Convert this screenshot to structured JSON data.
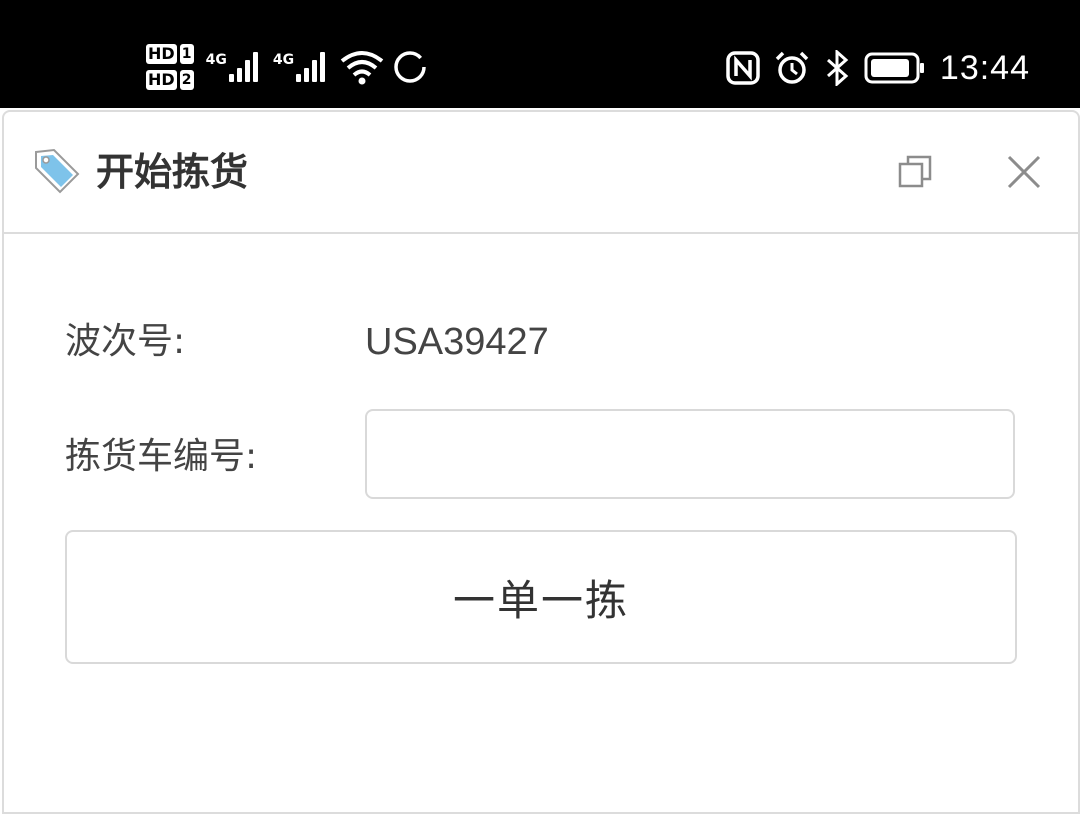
{
  "status_bar": {
    "hd1": "HD",
    "hd1_num": "1",
    "hd2": "HD",
    "hd2_num": "2",
    "network1": "4G",
    "network2": "4G",
    "time": "13:44",
    "icons": [
      "nfc-icon",
      "alarm-icon",
      "bluetooth-icon",
      "battery-icon",
      "wifi-icon",
      "loading-ring-icon"
    ]
  },
  "dialog": {
    "title": "开始拣货",
    "title_icon": "price-tag-icon",
    "restore_icon": "restore-window-icon",
    "close_icon": "close-icon"
  },
  "form": {
    "wave_label": "波次号:",
    "wave_value": "USA39427",
    "cart_label": "拣货车编号:",
    "cart_value": "",
    "cart_placeholder": ""
  },
  "actions": {
    "single_pick_label": "一单一拣"
  },
  "colors": {
    "status_bar_bg": "#000000",
    "border": "#dcdcdc",
    "text": "#444444",
    "tag_icon": "#7ec3ea"
  }
}
